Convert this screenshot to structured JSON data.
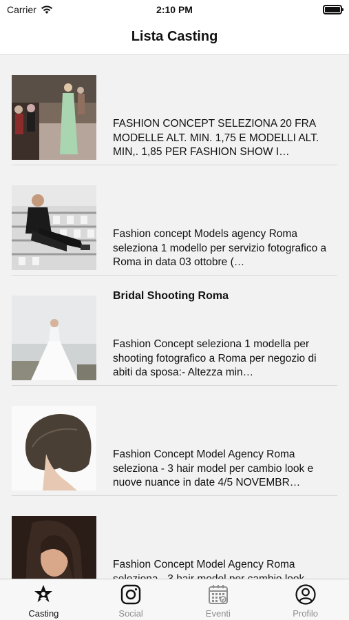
{
  "status": {
    "carrier": "Carrier",
    "time": "2:10 PM"
  },
  "nav": {
    "title": "Lista Casting"
  },
  "castings": [
    {
      "title": "",
      "desc": "FASHION CONCEPT SELEZIONA 20 FRA MODELLE ALT. MIN. 1,75 E MODELLI ALT. MIN,. 1,85 PER FASHION SHOW I…",
      "image": "runway-photo"
    },
    {
      "title": "",
      "desc": "Fashion concept Models agency Roma seleziona 1 modello per servizio fotografico a Roma in data 03 ottobre (…",
      "image": "male-model-stadium-photo"
    },
    {
      "title": "Bridal Shooting Roma",
      "desc": "Fashion Concept seleziona 1 modella per shooting fotografico a Roma per negozio di abiti da sposa:- Altezza min…",
      "image": "bride-photo"
    },
    {
      "title": "",
      "desc": "Fashion Concept Model Agency Roma seleziona - 3 hair model per cambio look e nuove nuance in date 4/5 NOVEMBR…",
      "image": "bob-haircut-photo"
    },
    {
      "title": "",
      "desc": "Fashion Concept Model Agency Roma seleziona - 3 hair model per cambio look",
      "image": "hair-model-photo"
    }
  ],
  "tabs": [
    {
      "label": "Casting",
      "icon": "star-person-icon",
      "active": true
    },
    {
      "label": "Social",
      "icon": "instagram-icon",
      "active": false
    },
    {
      "label": "Eventi",
      "icon": "calendar-icon",
      "active": false
    },
    {
      "label": "Profilo",
      "icon": "profile-icon",
      "active": false
    }
  ],
  "colors": {
    "active": "#111111",
    "inactive": "#8e8e8e",
    "background": "#f2f2f2"
  }
}
